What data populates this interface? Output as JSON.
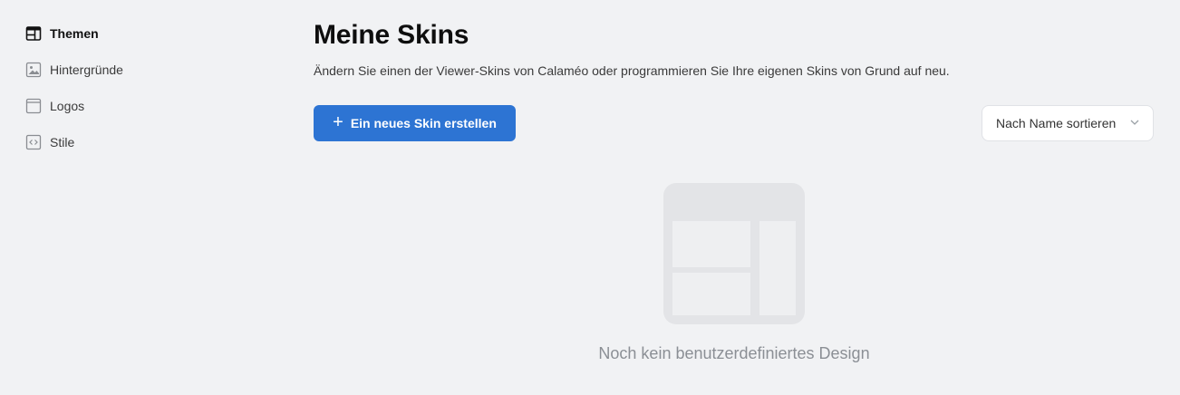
{
  "sidebar": {
    "items": [
      {
        "label": "Themen",
        "icon": "layout-icon",
        "active": true
      },
      {
        "label": "Hintergründe",
        "icon": "image-icon",
        "active": false
      },
      {
        "label": "Logos",
        "icon": "logo-frame-icon",
        "active": false
      },
      {
        "label": "Stile",
        "icon": "code-icon",
        "active": false
      }
    ]
  },
  "main": {
    "title": "Meine Skins",
    "description": "Ändern Sie einen der Viewer-Skins von Calaméo oder programmieren Sie Ihre eigenen Skins von Grund auf neu.",
    "create_button": {
      "icon": "plus-icon",
      "label": "Ein neues Skin erstellen"
    },
    "sort": {
      "selected": "Nach Name sortieren",
      "icon": "chevron-down-icon"
    },
    "empty_state": {
      "icon": "layout-placeholder-icon",
      "text": "Noch kein benutzerdefiniertes Design"
    }
  },
  "colors": {
    "background": "#f1f2f4",
    "primary": "#2d74d3",
    "placeholder": "#e3e4e7"
  }
}
